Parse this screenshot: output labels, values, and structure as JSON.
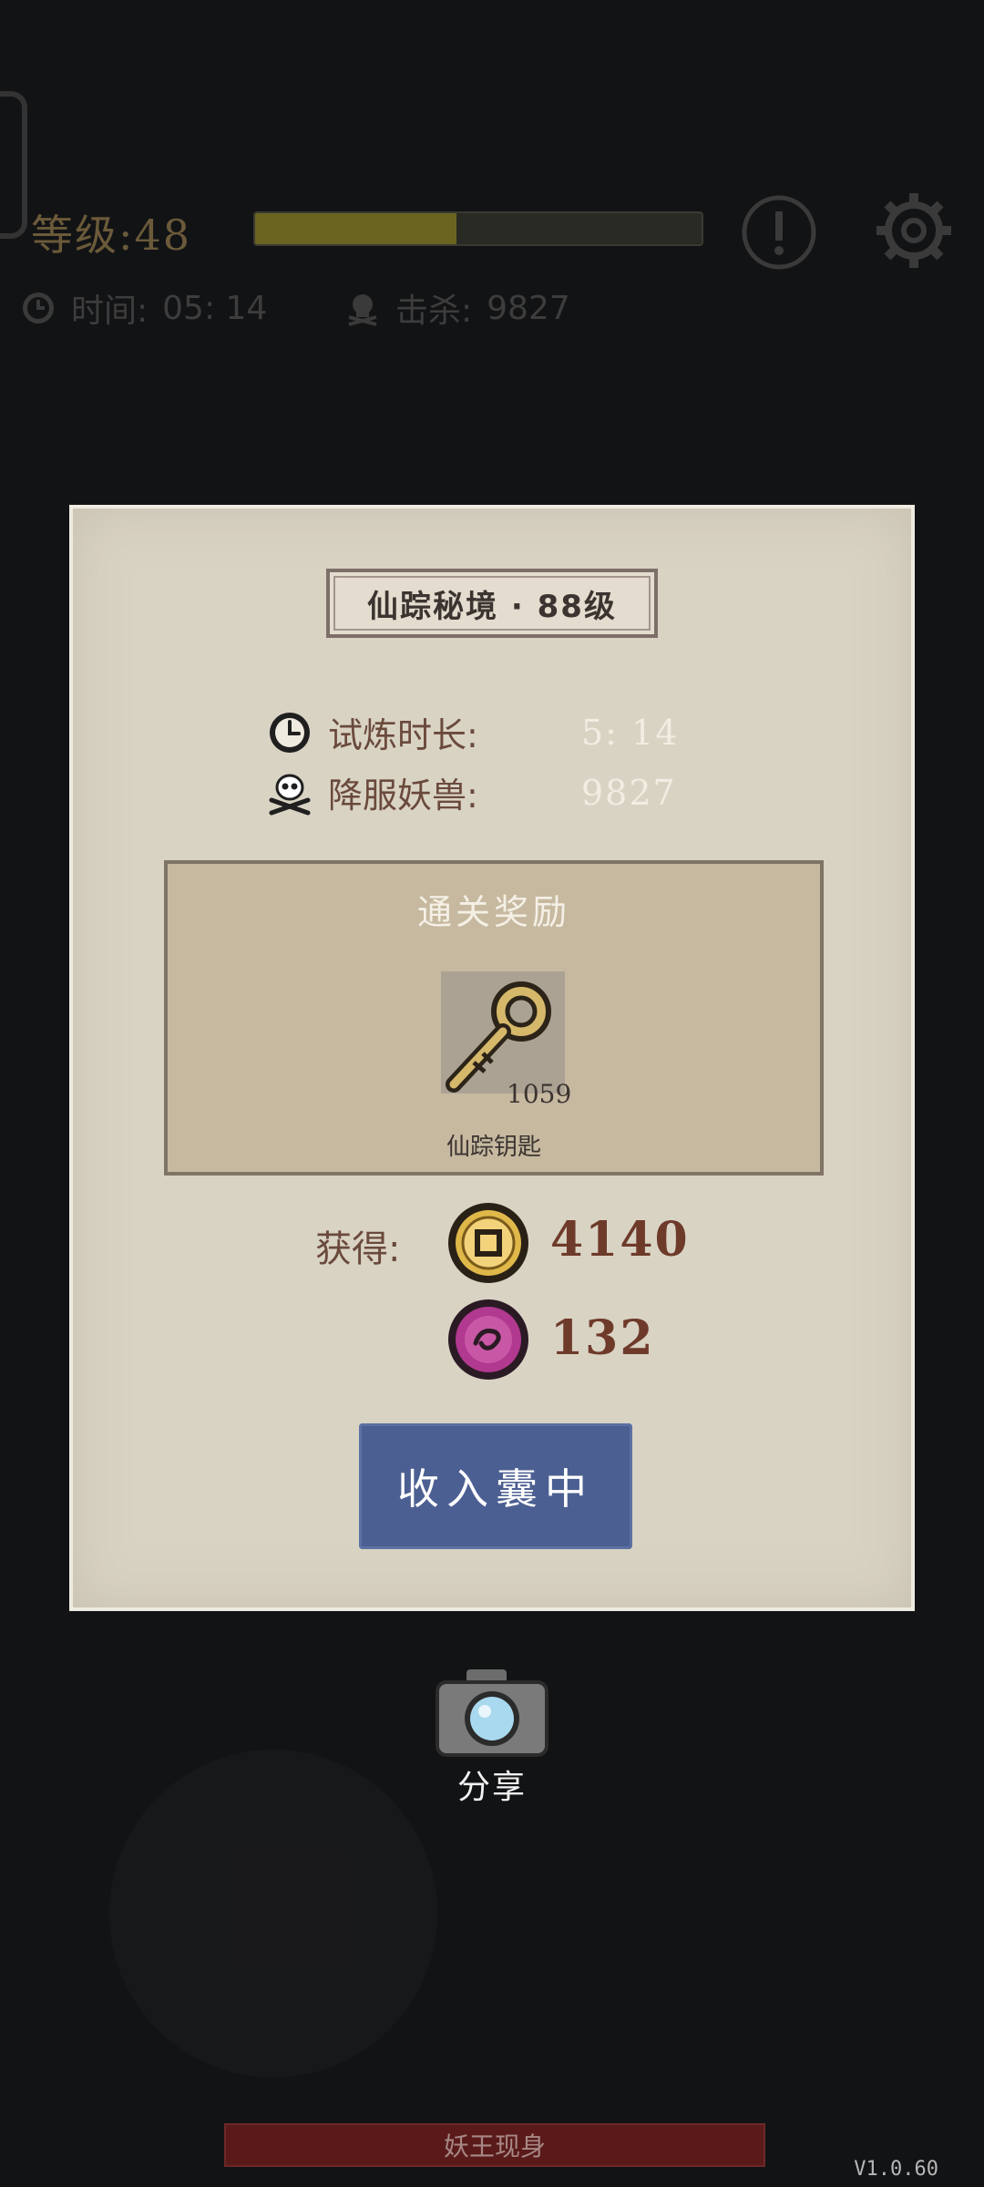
{
  "hud": {
    "level_label": "等级:48",
    "xp_progress": 0.45,
    "time_label": "时间:",
    "time_value": "05: 14",
    "kill_label": "击杀:",
    "kill_value": "9827"
  },
  "modal": {
    "title": "仙踪秘境 · 88级",
    "duration_label": "试炼时长:",
    "duration_value": "5: 14",
    "kills_label": "降服妖兽:",
    "kills_value": "9827",
    "reward": {
      "title": "通关奖励",
      "item_count": "1059",
      "item_name": "仙踪钥匙"
    },
    "gain_label": "获得:",
    "coins": "4140",
    "gems": "132",
    "collect_button": "收入囊中"
  },
  "share_label": "分享",
  "boss_bar_label": "妖王现身",
  "version": "V1.0.60",
  "colors": {
    "modal_bg": "#d9d3c4",
    "button_blue": "#4c5f92",
    "value_brown": "#6e3a2a",
    "background": "#121315"
  },
  "icons": [
    "clock-icon",
    "skull-icon",
    "gear-icon",
    "warning-icon",
    "key-icon",
    "gold-coin-icon",
    "purple-gem-icon",
    "camera-icon"
  ]
}
